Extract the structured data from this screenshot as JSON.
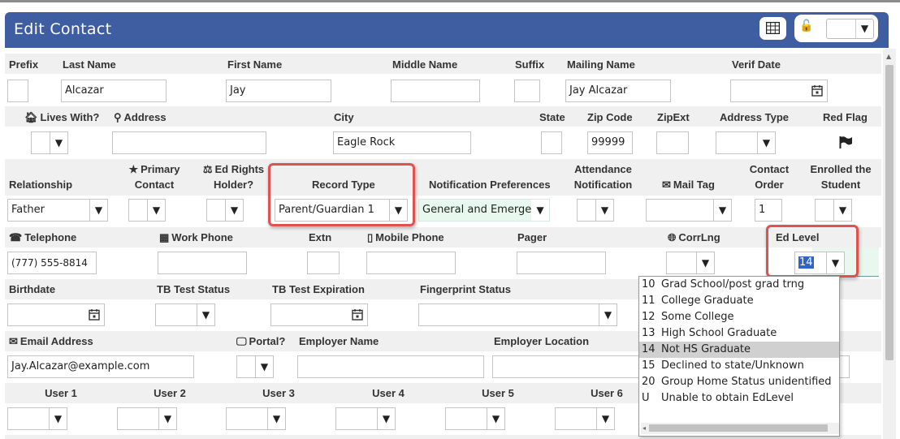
{
  "header": {
    "title": "Edit Contact"
  },
  "colors": {
    "header": "#3f5ea1",
    "highlight": "#e05250",
    "selected_field": "#e8f8ef"
  },
  "row1": {
    "labels": {
      "prefix": "Prefix",
      "last_name": "Last Name",
      "first_name": "First Name",
      "middle_name": "Middle Name",
      "suffix": "Suffix",
      "mailing_name": "Mailing Name",
      "verif_date": "Verif Date"
    },
    "values": {
      "prefix": "",
      "last_name": "Alcazar",
      "first_name": "Jay",
      "middle_name": "",
      "suffix": "",
      "mailing_name": "Jay Alcazar",
      "verif_date": ""
    }
  },
  "row2": {
    "labels": {
      "lives_with": "Lives With?",
      "address": "Address",
      "city": "City",
      "state": "State",
      "zip": "Zip Code",
      "zipext": "ZipExt",
      "address_type": "Address Type",
      "red_flag": "Red Flag"
    },
    "values": {
      "lives_with": "",
      "address": "",
      "city": "Eagle Rock",
      "state": "",
      "zip": "99999",
      "zipext": "",
      "address_type": ""
    }
  },
  "row3": {
    "labels": {
      "relationship": "Relationship",
      "primary_contact_1": "Primary",
      "primary_contact_2": "Contact",
      "ed_rights_1": "Ed Rights",
      "ed_rights_2": "Holder?",
      "record_type": "Record Type",
      "notification_prefs": "Notification Preferences",
      "attendance_1": "Attendance",
      "attendance_2": "Notification",
      "mail_tag": "Mail Tag",
      "contact_order_1": "Contact",
      "contact_order_2": "Order",
      "enrolled_1": "Enrolled the",
      "enrolled_2": "Student"
    },
    "values": {
      "relationship": "Father",
      "primary_contact": "",
      "ed_rights": "",
      "record_type": "Parent/Guardian 1",
      "notification_prefs": "General and Emerge",
      "attendance": "",
      "mail_tag": "",
      "contact_order": "1",
      "enrolled": ""
    }
  },
  "row4": {
    "labels": {
      "telephone": "Telephone",
      "work_phone": "Work Phone",
      "extn": "Extn",
      "mobile_phone": "Mobile Phone",
      "pager": "Pager",
      "corrlng": "CorrLng",
      "ed_level": "Ed Level"
    },
    "values": {
      "telephone": "(777) 555-8814",
      "work_phone": "",
      "extn": "",
      "mobile_phone": "",
      "pager": "",
      "corrlng": "",
      "ed_level": "14"
    }
  },
  "row5": {
    "labels": {
      "birthdate": "Birthdate",
      "tb_status": "TB Test Status",
      "tb_expiration": "TB Test Expiration",
      "fingerprint": "Fingerprint Status"
    },
    "values": {
      "birthdate": "",
      "tb_status": "",
      "tb_expiration": "",
      "fingerprint": ""
    }
  },
  "row6": {
    "labels": {
      "email": "Email Address",
      "portal": "Portal?",
      "employer_name": "Employer Name",
      "employer_location": "Employer Location"
    },
    "values": {
      "email": "Jay.Alcazar@example.com",
      "portal": "",
      "employer_name": "",
      "employer_location": ""
    }
  },
  "row7": {
    "labels": {
      "user1": "User 1",
      "user2": "User 2",
      "user3": "User 3",
      "user4": "User 4",
      "user5": "User 5",
      "user6": "User 6"
    }
  },
  "ed_level_dropdown": {
    "options": [
      {
        "code": "10",
        "label": "Grad School/post grad trng"
      },
      {
        "code": "11",
        "label": "College Graduate"
      },
      {
        "code": "12",
        "label": "Some College"
      },
      {
        "code": "13",
        "label": "High School Graduate"
      },
      {
        "code": "14",
        "label": "Not HS Graduate",
        "selected": true
      },
      {
        "code": "15",
        "label": "Declined to state/Unknown"
      },
      {
        "code": "20",
        "label": "Group Home Status unidentified"
      },
      {
        "code": "U",
        "label": "Unable to obtain EdLevel"
      }
    ]
  },
  "icons": {
    "arrow": "▼",
    "home": "home-icon",
    "pin": "map-pin-icon",
    "star": "star-icon",
    "scales": "scales-icon",
    "envelope": "envelope-icon",
    "phone": "phone-icon",
    "building": "building-icon",
    "mobile": "mobile-icon",
    "globe": "globe-icon",
    "monitor": "monitor-icon",
    "flag": "flag-icon",
    "lock": "unlock-icon",
    "grid": "grid-icon",
    "calendar": "calendar-icon"
  }
}
